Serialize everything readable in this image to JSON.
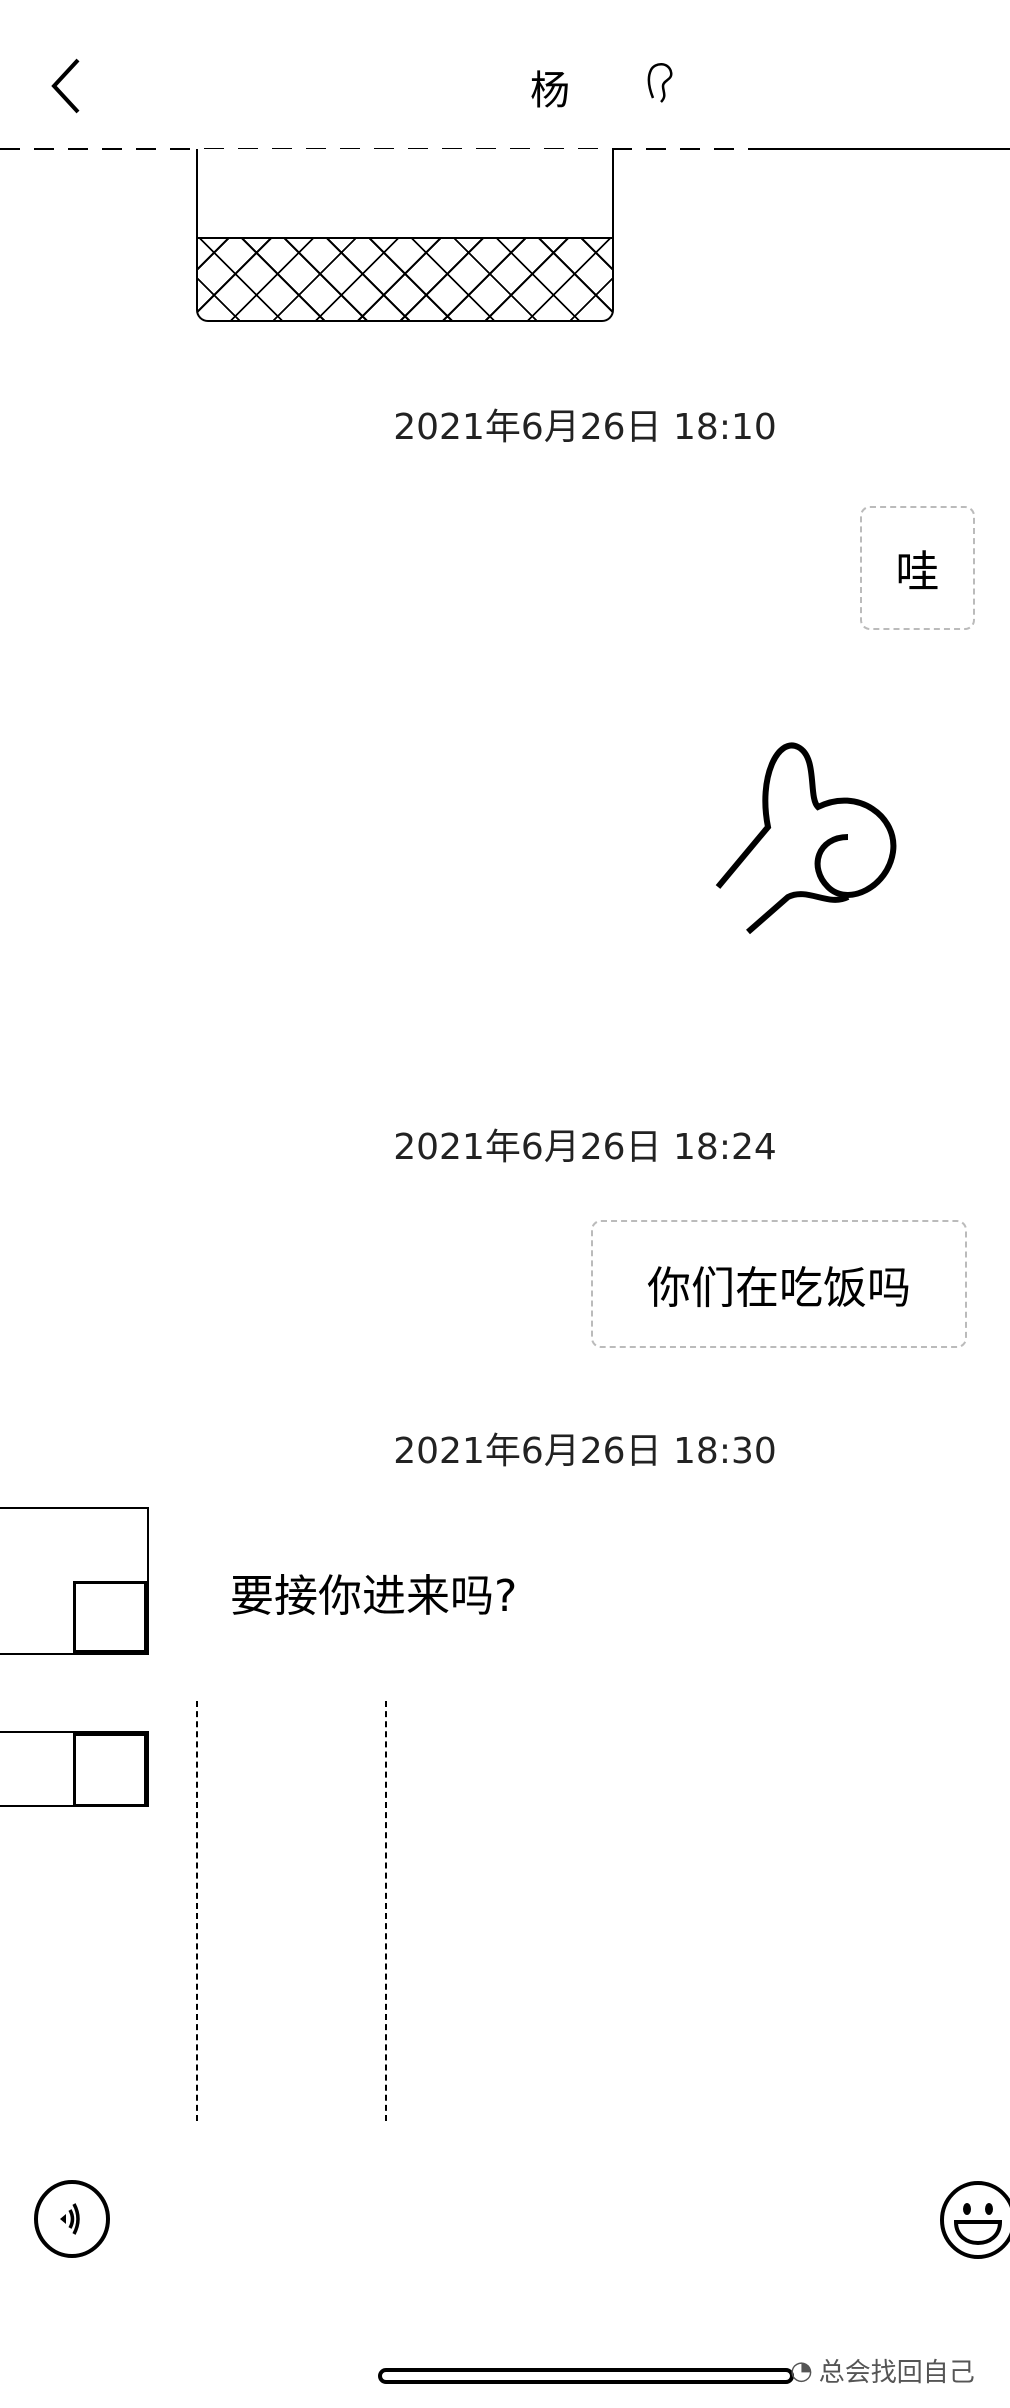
{
  "header": {
    "title": "杨",
    "back_icon": "chevron-left-icon",
    "title_icon": "ear-icon"
  },
  "messages": [
    {
      "type": "timestamp",
      "text": "2021年6月26日 18:10"
    },
    {
      "type": "text",
      "side": "right",
      "text": "哇"
    },
    {
      "type": "sticker",
      "side": "right",
      "icon": "heart-hands-icon"
    },
    {
      "type": "timestamp",
      "text": "2021年6月26日 18:24"
    },
    {
      "type": "text",
      "side": "right",
      "text": "你们在吃饭吗"
    },
    {
      "type": "timestamp",
      "text": "2021年6月26日 18:30"
    },
    {
      "type": "text",
      "side": "left",
      "text": "要接你进来吗?"
    }
  ],
  "footer": {
    "voice_icon": "voice-icon",
    "emoji_icon": "emoji-icon"
  },
  "watermark": "总会找回自己"
}
